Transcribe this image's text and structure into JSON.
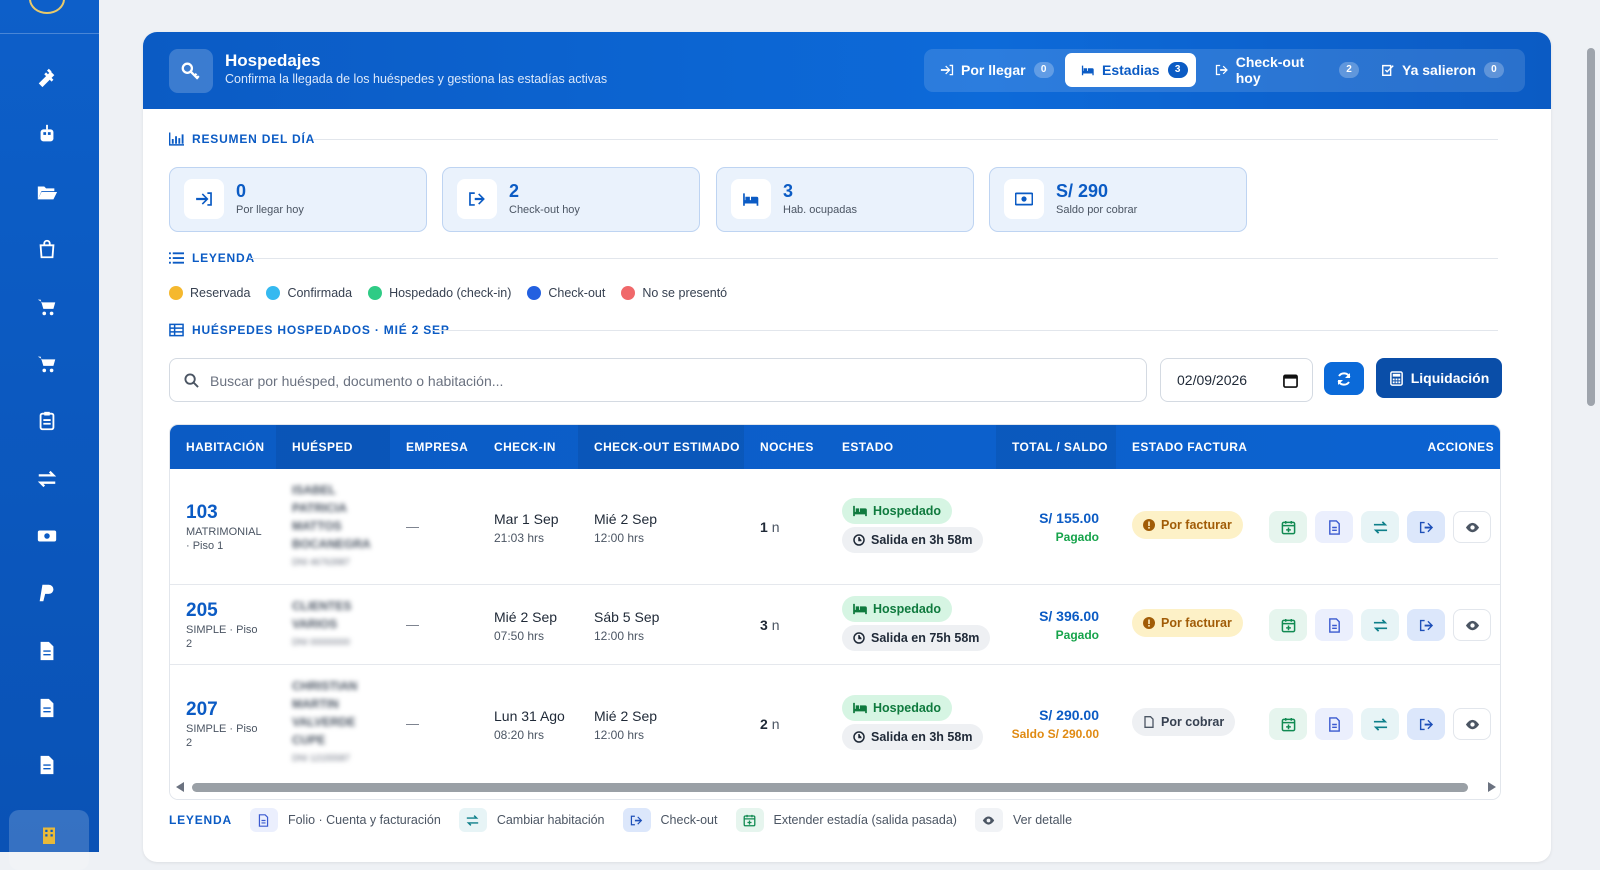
{
  "header": {
    "title": "Hospedajes",
    "subtitle": "Confirma la llegada de los huéspedes y gestiona las estadías activas",
    "tabs": [
      {
        "label": "Por llegar",
        "count": "0"
      },
      {
        "label": "Estadias",
        "count": "3"
      },
      {
        "label": "Check-out hoy",
        "count": "2"
      },
      {
        "label": "Ya salieron",
        "count": "0"
      }
    ]
  },
  "summary": {
    "title": "RESUMEN DEL DÍA",
    "cards": [
      {
        "value": "0",
        "label": "Por llegar hoy"
      },
      {
        "value": "2",
        "label": "Check-out hoy"
      },
      {
        "value": "3",
        "label": "Hab. ocupadas"
      },
      {
        "value": "S/ 290",
        "label": "Saldo por cobrar"
      }
    ]
  },
  "legend": {
    "title": "LEYENDA",
    "items": [
      {
        "label": "Reservada",
        "color": "#f5b82e"
      },
      {
        "label": "Confirmada",
        "color": "#35b9f0"
      },
      {
        "label": "Hospedado (check-in)",
        "color": "#2fcb85"
      },
      {
        "label": "Check-out",
        "color": "#2360e0"
      },
      {
        "label": "No se presentó",
        "color": "#f0686a"
      }
    ]
  },
  "guests_section": {
    "title": "HUÉSPEDES HOSPEDADOS · MIÉ 2 SEP"
  },
  "search": {
    "placeholder": "Buscar por huésped, documento o habitación..."
  },
  "date": {
    "value": "02/09/2026"
  },
  "liquidacion_label": "Liquidación",
  "table": {
    "headers": [
      "HABITACIÓN",
      "HUÉSPED",
      "EMPRESA",
      "CHECK-IN",
      "CHECK-OUT ESTIMADO",
      "NOCHES",
      "ESTADO",
      "TOTAL / SALDO",
      "ESTADO FACTURA",
      "ACCIONES"
    ],
    "rows": [
      {
        "room": "103",
        "room_type": "MATRIMONIAL · Piso 1",
        "guest": "ISABEL PATRICIA MATTOS BOCANEGRA",
        "doc": "DNI 46763987",
        "company": "—",
        "checkin_date": "Mar 1 Sep",
        "checkin_time": "21:03 hrs",
        "checkout_date": "Mié 2 Sep",
        "checkout_time": "12:00 hrs",
        "nights": "1",
        "nights_unit": "n",
        "status": "Hospedado",
        "exit": "Salida en 3h 58m",
        "total": "S/ 155.00",
        "balance": "Pagado",
        "balance_color": "#15a34a",
        "invoice": "Por facturar",
        "invoice_type": "pending"
      },
      {
        "room": "205",
        "room_type": "SIMPLE · Piso 2",
        "guest": "CLIENTES VARIOS",
        "doc": "DNI 00000000",
        "company": "—",
        "checkin_date": "Mié 2 Sep",
        "checkin_time": "07:50 hrs",
        "checkout_date": "Sáb 5 Sep",
        "checkout_time": "12:00 hrs",
        "nights": "3",
        "nights_unit": "n",
        "status": "Hospedado",
        "exit": "Salida en 75h 58m",
        "total": "S/ 396.00",
        "balance": "Pagado",
        "balance_color": "#15a34a",
        "invoice": "Por facturar",
        "invoice_type": "pending"
      },
      {
        "room": "207",
        "room_type": "SIMPLE · Piso 2",
        "guest": "CHRISTIAN MARTIN VALVERDE CUPE",
        "doc": "DNI 12155587",
        "company": "—",
        "checkin_date": "Lun 31 Ago",
        "checkin_time": "08:20 hrs",
        "checkout_date": "Mié 2 Sep",
        "checkout_time": "12:00 hrs",
        "nights": "2",
        "nights_unit": "n",
        "status": "Hospedado",
        "exit": "Salida en 3h 58m",
        "total": "S/ 290.00",
        "balance": "Saldo S/ 290.00",
        "balance_color": "#e08a12",
        "invoice": "Por cobrar",
        "invoice_type": "collect"
      }
    ]
  },
  "footer_legend": {
    "title": "LEYENDA",
    "items": [
      {
        "label": "Folio · Cuenta y facturación",
        "icon": "document-icon"
      },
      {
        "label": "Cambiar habitación",
        "icon": "swap-icon"
      },
      {
        "label": "Check-out",
        "icon": "exit-icon"
      },
      {
        "label": "Extender estadía (salida pasada)",
        "icon": "calendar-plus-icon"
      },
      {
        "label": "Ver detalle",
        "icon": "eye-icon"
      }
    ]
  }
}
